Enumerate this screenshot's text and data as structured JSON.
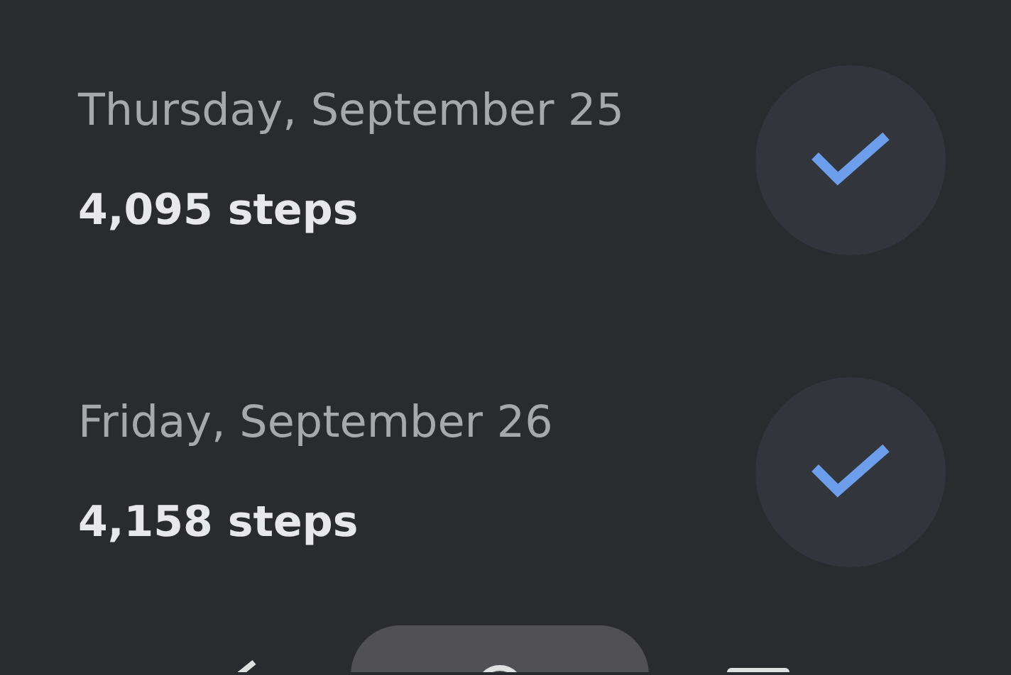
{
  "days": [
    {
      "date": "Thursday, September 25",
      "steps": "4,095 steps",
      "completed": true
    },
    {
      "date": "Friday, September 26",
      "steps": "4,158 steps",
      "completed": true
    }
  ]
}
